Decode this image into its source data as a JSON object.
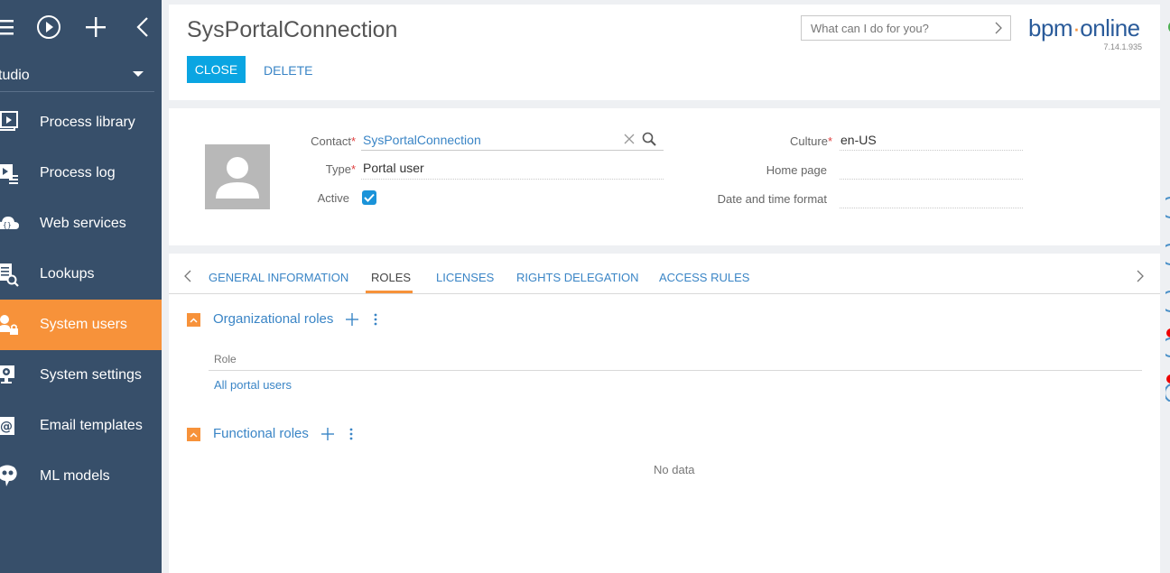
{
  "sidebar": {
    "studio_label": "tudio",
    "items": [
      {
        "label": "Process library",
        "icon": "process-library-icon",
        "active": false
      },
      {
        "label": "Process log",
        "icon": "process-log-icon",
        "active": false
      },
      {
        "label": "Web services",
        "icon": "web-services-icon",
        "active": false
      },
      {
        "label": "Lookups",
        "icon": "lookups-icon",
        "active": false
      },
      {
        "label": "System users",
        "icon": "system-users-icon",
        "active": true
      },
      {
        "label": "System settings",
        "icon": "system-settings-icon",
        "active": false
      },
      {
        "label": "Email templates",
        "icon": "email-templates-icon",
        "active": false
      },
      {
        "label": "ML models",
        "icon": "ml-models-icon",
        "active": false
      }
    ]
  },
  "header": {
    "title": "SysPortalConnection",
    "close_label": "CLOSE",
    "delete_label": "DELETE",
    "search_placeholder": "What can I do for you?",
    "logo_text_a": "bpm",
    "logo_text_b": "online",
    "version": "7.14.1.935"
  },
  "profile": {
    "contact_label": "Contact",
    "contact_value": "SysPortalConnection",
    "type_label": "Type",
    "type_value": "Portal user",
    "active_label": "Active",
    "active_checked": true,
    "culture_label": "Culture",
    "culture_value": "en-US",
    "home_page_label": "Home page",
    "home_page_value": "",
    "datetime_label": "Date and time format",
    "datetime_value": "",
    "required_mark": "*"
  },
  "tabs": {
    "items": [
      "GENERAL INFORMATION",
      "ROLES",
      "LICENSES",
      "RIGHTS DELEGATION",
      "ACCESS RULES"
    ],
    "active": "ROLES"
  },
  "roles": {
    "org_title": "Organizational roles",
    "column_role": "Role",
    "org_rows": [
      "All portal users"
    ],
    "func_title": "Functional roles",
    "no_data": "No data"
  },
  "colors": {
    "sidebar_bg": "#374f6a",
    "accent_orange": "#f7923a",
    "primary_blue": "#0aa5e2",
    "link_blue": "#3a85c6"
  }
}
